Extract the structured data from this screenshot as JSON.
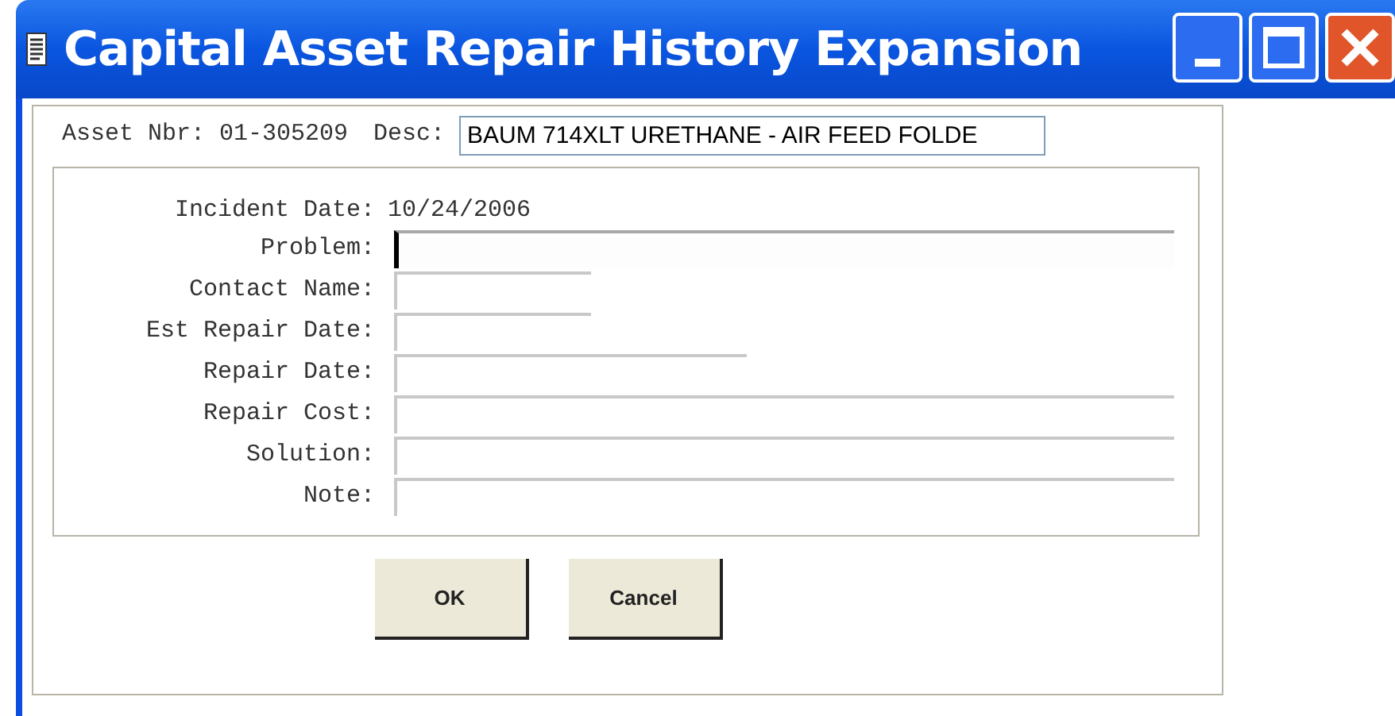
{
  "window": {
    "title": "Capital Asset Repair History Expansion"
  },
  "header": {
    "asset_label": "Asset Nbr:",
    "asset_value": "01-305209",
    "desc_label": "Desc:",
    "desc_value": "BAUM 714XLT URETHANE - AIR FEED FOLDE"
  },
  "incident": {
    "label": "Incident Date:",
    "value": "10/24/2006"
  },
  "fields": [
    {
      "label": "Problem:",
      "kind": "long",
      "focused": true
    },
    {
      "label": "Contact Name:",
      "kind": "short",
      "focused": false
    },
    {
      "label": "Est Repair Date:",
      "kind": "short",
      "focused": false
    },
    {
      "label": "Repair Date:",
      "kind": "medium",
      "focused": false
    },
    {
      "label": "Repair Cost:",
      "kind": "long",
      "focused": false
    },
    {
      "label": "Solution:",
      "kind": "long",
      "focused": false
    },
    {
      "label": "Note:",
      "kind": "long",
      "focused": false
    }
  ],
  "buttons": [
    "OK",
    "Cancel"
  ]
}
